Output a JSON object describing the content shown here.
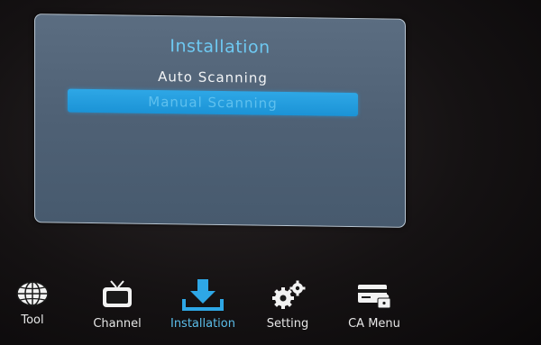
{
  "dialog": {
    "title": "Installation",
    "items": [
      {
        "label": "Auto Scanning"
      },
      {
        "label": "Manual Scanning",
        "selected": true
      }
    ]
  },
  "bottom_nav": [
    {
      "label": "Tool",
      "icon": "globe-icon"
    },
    {
      "label": "Channel",
      "icon": "tv-icon"
    },
    {
      "label": "Installation",
      "icon": "download-icon",
      "active": true
    },
    {
      "label": "Setting",
      "icon": "gears-icon"
    },
    {
      "label": "CA Menu",
      "icon": "card-lock-icon"
    }
  ],
  "colors": {
    "accent": "#1b93d6",
    "title": "#6ec9f2",
    "panel": "#516377"
  }
}
